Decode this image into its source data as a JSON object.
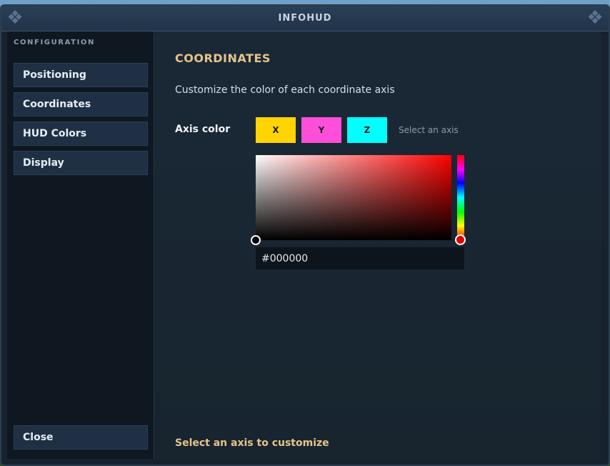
{
  "window": {
    "title": "INFOHUD"
  },
  "sidebar": {
    "heading": "CONFIGURATION",
    "items": [
      {
        "label": "Positioning"
      },
      {
        "label": "Coordinates"
      },
      {
        "label": "HUD Colors"
      },
      {
        "label": "Display"
      }
    ],
    "close_label": "Close"
  },
  "main": {
    "title": "COORDINATES",
    "description": "Customize the color of each coordinate axis",
    "axis_label": "Axis color",
    "axes": [
      {
        "label": "X",
        "color": "#ffd400"
      },
      {
        "label": "Y",
        "color": "#ff4fd8"
      },
      {
        "label": "Z",
        "color": "#00ffff"
      }
    ],
    "axis_hint": "Select an axis",
    "picker": {
      "hue_color": "#ff0000",
      "hex_value": "#000000"
    },
    "footer_hint": "Select an axis to customize"
  },
  "icons": {
    "corner_left": "ornament-icon",
    "corner_right": "ornament-icon"
  }
}
